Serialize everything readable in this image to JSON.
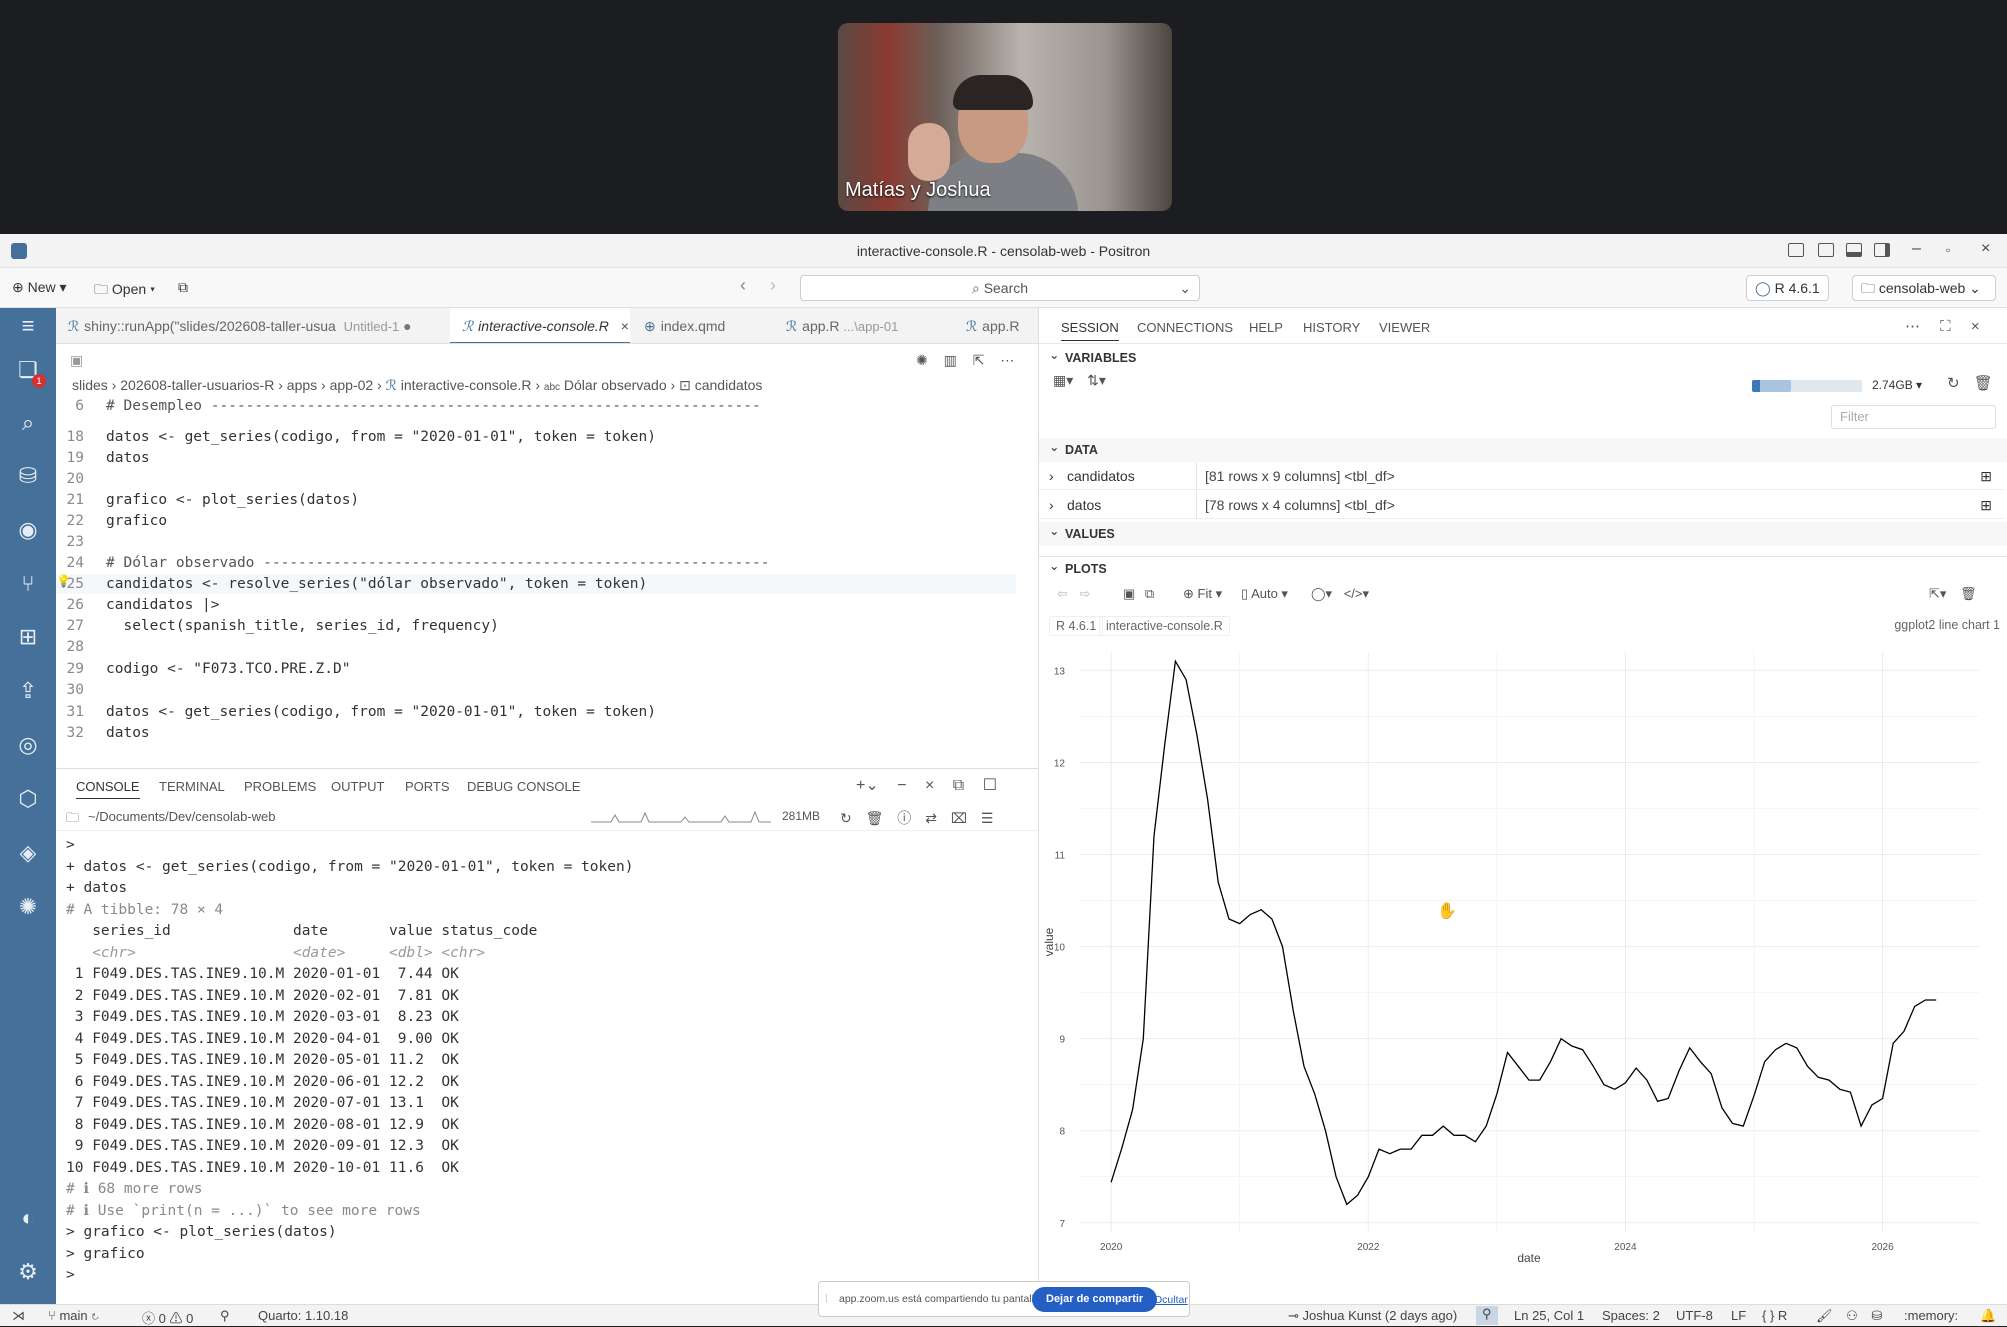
{
  "zoom": {
    "participant_name": "Matías y Joshua",
    "share_notice": "app.zoom.us está compartiendo tu pantalla.",
    "stop_button": "Dejar de compartir",
    "hide_link": "Ocultar"
  },
  "window": {
    "title": "interactive-console.R - censolab-web - Positron"
  },
  "toolbar": {
    "new_label": "New",
    "open_label": "Open",
    "search_placeholder": "Search",
    "r_version": "R 4.6.1",
    "project": "censolab-web"
  },
  "editor": {
    "tabs": [
      {
        "label": "shiny::runApp(\"slides/202608-taller-usua",
        "sub": "Untitled-1"
      },
      {
        "label": "interactive-console.R"
      },
      {
        "label": "index.qmd"
      },
      {
        "label": "app.R",
        "sub": "...\\app-01"
      },
      {
        "label": "app.R"
      }
    ],
    "breadcrumb": [
      "slides",
      "202608-taller-usuarios-R",
      "apps",
      "app-02",
      "interactive-console.R",
      "Dólar observado",
      "candidatos"
    ],
    "lines": [
      {
        "n": "6",
        "t": "# Desempleo ---------------------------------------------------------------"
      },
      {
        "n": "18",
        "t": "datos <- get_series(codigo, from = \"2020-01-01\", token = token)"
      },
      {
        "n": "19",
        "t": "datos"
      },
      {
        "n": "20",
        "t": ""
      },
      {
        "n": "21",
        "t": "grafico <- plot_series(datos)"
      },
      {
        "n": "22",
        "t": "grafico"
      },
      {
        "n": "23",
        "t": ""
      },
      {
        "n": "24",
        "t": "# Dólar observado ----------------------------------------------------------"
      },
      {
        "n": "25",
        "t": "candidatos <- resolve_series(\"dólar observado\", token = token)"
      },
      {
        "n": "26",
        "t": "candidatos |>"
      },
      {
        "n": "27",
        "t": "  select(spanish_title, series_id, frequency)"
      },
      {
        "n": "28",
        "t": ""
      },
      {
        "n": "29",
        "t": "codigo <- \"F073.TCO.PRE.Z.D\""
      },
      {
        "n": "30",
        "t": ""
      },
      {
        "n": "31",
        "t": "datos <- get_series(codigo, from = \"2020-01-01\", token = token)"
      },
      {
        "n": "32",
        "t": "datos"
      }
    ]
  },
  "panel": {
    "tabs": [
      "CONSOLE",
      "TERMINAL",
      "PROBLEMS",
      "OUTPUT",
      "PORTS",
      "DEBUG CONSOLE"
    ],
    "cwd": "~/Documents/Dev/censolab-web",
    "mem": "281MB",
    "console_lines": [
      ">",
      "+ datos <- get_series(codigo, from = \"2020-01-01\", token = token)",
      "+ datos",
      "# A tibble: 78 × 4",
      "   series_id              date       value status_code",
      "   <chr>                  <date>     <dbl> <chr>",
      " 1 F049.DES.TAS.INE9.10.M 2020-01-01  7.44 OK",
      " 2 F049.DES.TAS.INE9.10.M 2020-02-01  7.81 OK",
      " 3 F049.DES.TAS.INE9.10.M 2020-03-01  8.23 OK",
      " 4 F049.DES.TAS.INE9.10.M 2020-04-01  9.00 OK",
      " 5 F049.DES.TAS.INE9.10.M 2020-05-01 11.2  OK",
      " 6 F049.DES.TAS.INE9.10.M 2020-06-01 12.2  OK",
      " 7 F049.DES.TAS.INE9.10.M 2020-07-01 13.1  OK",
      " 8 F049.DES.TAS.INE9.10.M 2020-08-01 12.9  OK",
      " 9 F049.DES.TAS.INE9.10.M 2020-09-01 12.3  OK",
      "10 F049.DES.TAS.INE9.10.M 2020-10-01 11.6  OK",
      "# ℹ 68 more rows",
      "# ℹ Use `print(n = ...)` to see more rows",
      "> grafico <- plot_series(datos)",
      "> grafico",
      ">"
    ]
  },
  "session": {
    "tabs": [
      "SESSION",
      "CONNECTIONS",
      "HELP",
      "HISTORY",
      "VIEWER"
    ],
    "variables_label": "VARIABLES",
    "memory": "2.74GB",
    "memory_fraction": 0.35,
    "filter_placeholder": "Filter",
    "data_label": "DATA",
    "values_label": "VALUES",
    "plots_label": "PLOTS",
    "variables": [
      {
        "name": "candidatos",
        "value": "[81 rows x 9 columns] <tbl_df>"
      },
      {
        "name": "datos",
        "value": "[78 rows x 4 columns] <tbl_df>"
      }
    ],
    "plot_fit": "Fit",
    "plot_auto": "Auto",
    "plot_runtime": "R 4.6.1",
    "plot_source": "interactive-console.R",
    "plot_name": "ggplot2 line chart 1"
  },
  "statusbar": {
    "branch": "main",
    "errors": "0",
    "warnings": "0",
    "quarto": "Quarto: 1.10.18",
    "author": "Joshua Kunst (2 days ago)",
    "position": "Ln 25, Col 1",
    "spaces": "Spaces: 2",
    "encoding": "UTF-8",
    "eol": "LF",
    "language": "R",
    "memory": ":memory:"
  },
  "chart_data": {
    "type": "line",
    "xlabel": "date",
    "ylabel": "value",
    "x_tick_labels": [
      "2020",
      "2022",
      "2024",
      "2026"
    ],
    "y_tick_labels": [
      "7",
      "8",
      "9",
      "10",
      "11",
      "12",
      "13"
    ],
    "xlim": [
      2019.75,
      2026.75
    ],
    "ylim": [
      6.9,
      13.2
    ],
    "grid": true,
    "x": [
      2020.0,
      2020.083,
      2020.167,
      2020.25,
      2020.333,
      2020.417,
      2020.5,
      2020.583,
      2020.667,
      2020.75,
      2020.833,
      2020.917,
      2021.0,
      2021.083,
      2021.167,
      2021.25,
      2021.333,
      2021.417,
      2021.5,
      2021.583,
      2021.667,
      2021.75,
      2021.833,
      2021.917,
      2022.0,
      2022.083,
      2022.167,
      2022.25,
      2022.333,
      2022.417,
      2022.5,
      2022.583,
      2022.667,
      2022.75,
      2022.833,
      2022.917,
      2023.0,
      2023.083,
      2023.167,
      2023.25,
      2023.333,
      2023.417,
      2023.5,
      2023.583,
      2023.667,
      2023.75,
      2023.833,
      2023.917,
      2024.0,
      2024.083,
      2024.167,
      2024.25,
      2024.333,
      2024.417,
      2024.5,
      2024.583,
      2024.667,
      2024.75,
      2024.833,
      2024.917,
      2025.0,
      2025.083,
      2025.167,
      2025.25,
      2025.333,
      2025.417,
      2025.5,
      2025.583,
      2025.667,
      2025.75,
      2025.833,
      2025.917,
      2026.0,
      2026.083,
      2026.167,
      2026.25,
      2026.333,
      2026.417
    ],
    "y": [
      7.44,
      7.81,
      8.23,
      9.0,
      11.2,
      12.2,
      13.1,
      12.9,
      12.3,
      11.6,
      10.7,
      10.3,
      10.25,
      10.35,
      10.4,
      10.3,
      10.0,
      9.3,
      8.7,
      8.4,
      8.0,
      7.5,
      7.2,
      7.3,
      7.5,
      7.8,
      7.75,
      7.8,
      7.8,
      7.95,
      7.95,
      8.05,
      7.95,
      7.95,
      7.88,
      8.05,
      8.4,
      8.85,
      8.7,
      8.55,
      8.55,
      8.75,
      9.0,
      8.92,
      8.88,
      8.7,
      8.5,
      8.45,
      8.52,
      8.68,
      8.55,
      8.32,
      8.35,
      8.65,
      8.9,
      8.75,
      8.62,
      8.25,
      8.08,
      8.05,
      8.38,
      8.75,
      8.88,
      8.95,
      8.9,
      8.7,
      8.58,
      8.55,
      8.45,
      8.42,
      8.05,
      8.28,
      8.35,
      8.95,
      9.08,
      9.35,
      9.42,
      9.42
    ],
    "line_color": "#000000"
  }
}
